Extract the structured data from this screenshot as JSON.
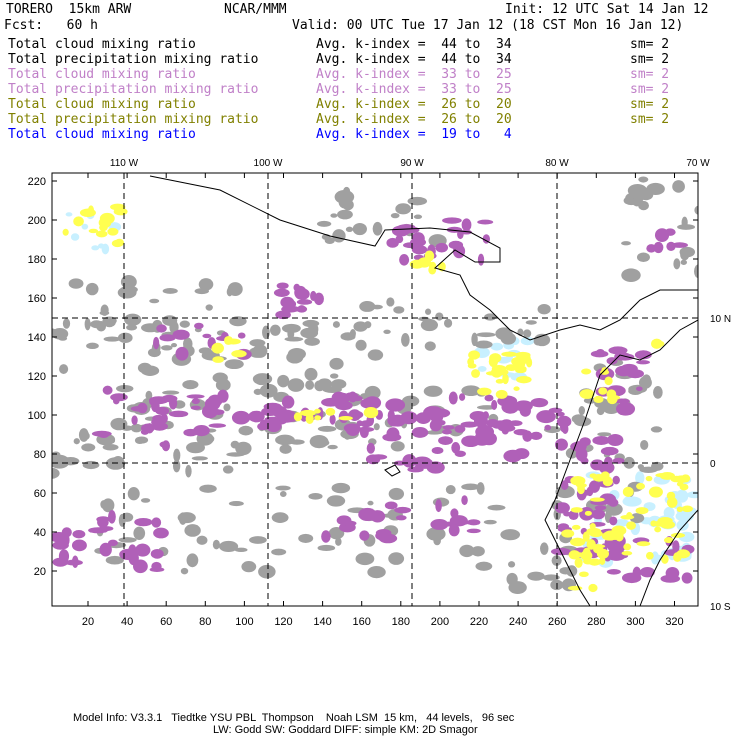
{
  "header": {
    "model": "TORERO  15km ARW",
    "org": "NCAR/MMM",
    "init": "Init: 12 UTC Sat 14 Jan 12",
    "fcst": "Fcst:   60 h",
    "valid": "Valid: 00 UTC Tue 17 Jan 12 (18 CST Mon 16 Jan 12)"
  },
  "legend": [
    {
      "field": "Total cloud mixing ratio",
      "range": "Avg. k-index =  44 to  34",
      "sm": "sm= 2",
      "color": "#000000"
    },
    {
      "field": "Total precipitation mixing ratio",
      "range": "Avg. k-index =  44 to  34",
      "sm": "sm= 2",
      "color": "#000000"
    },
    {
      "field": "Total cloud mixing ratio",
      "range": "Avg. k-index =  33 to  25",
      "sm": "sm= 2",
      "color": "#c080c8"
    },
    {
      "field": "Total precipitation mixing ratio",
      "range": "Avg. k-index =  33 to  25",
      "sm": "sm= 2",
      "color": "#c080c8"
    },
    {
      "field": "Total cloud mixing ratio",
      "range": "Avg. k-index =  26 to  20",
      "sm": "sm= 2",
      "color": "#808000"
    },
    {
      "field": "Total precipitation mixing ratio",
      "range": "Avg. k-index =  26 to  20",
      "sm": "sm= 2",
      "color": "#808000"
    },
    {
      "field": "Total cloud mixing ratio",
      "range": "Avg. k-index =  19 to   4",
      "sm": "",
      "color": "#0000ff"
    }
  ],
  "lon_labels": [
    "110 W",
    "100 W",
    "90 W",
    "80 W",
    "70 W"
  ],
  "lat_labels": [
    "10 N",
    "0",
    "10 S"
  ],
  "y_ticks": [
    "220",
    "200",
    "180",
    "160",
    "140",
    "120",
    "100",
    "80",
    "60",
    "40",
    "20"
  ],
  "x_ticks": [
    "20",
    "40",
    "60",
    "80",
    "100",
    "120",
    "140",
    "160",
    "180",
    "200",
    "220",
    "240",
    "260",
    "280",
    "300",
    "320"
  ],
  "footer": {
    "line1": "Model Info: V3.3.1   Tiedtke YSU PBL  Thompson    Noah LSM  15 km,   44 levels,   96 sec",
    "line2": "LW: Godd SW: Goddard DIFF: simple KM: 2D Smagor"
  },
  "colors": {
    "gray": "#a0a0a0",
    "purple": "#b060b8",
    "yellow": "#ffff50",
    "lightblue": "#c8f0ff"
  }
}
